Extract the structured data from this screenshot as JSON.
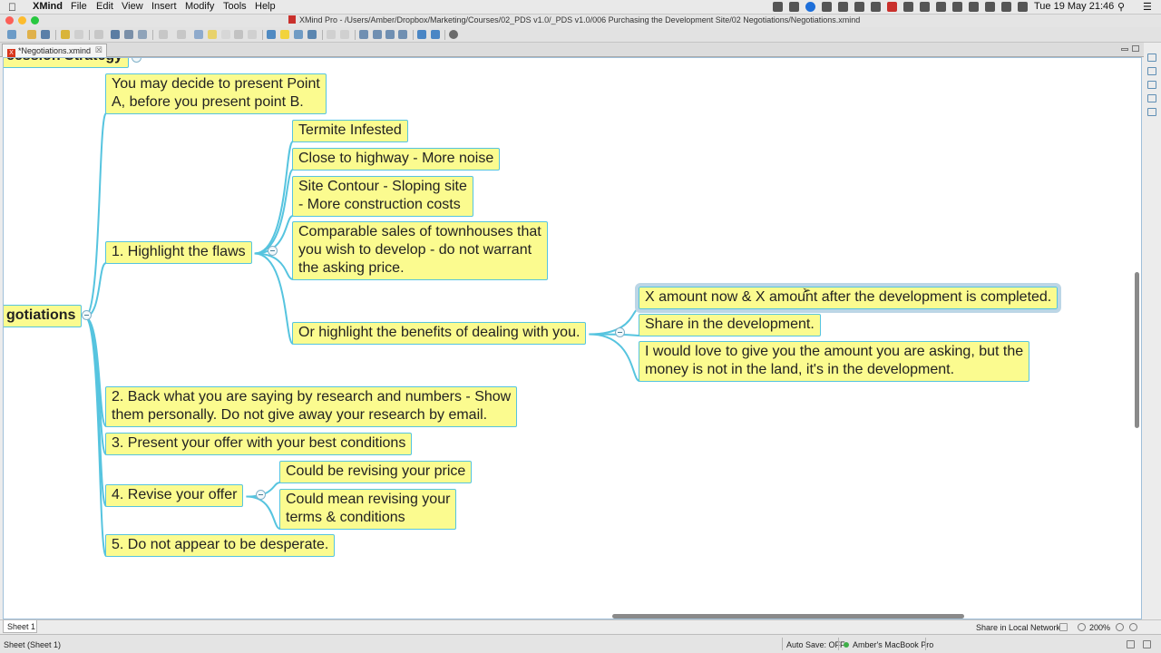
{
  "menubar": {
    "apple": "",
    "app_name": "XMind",
    "items": [
      "File",
      "Edit",
      "View",
      "Insert",
      "Modify",
      "Tools",
      "Help"
    ],
    "clock": "Tue 19 May  21:46"
  },
  "window": {
    "title": "XMind Pro - /Users/Amber/Dropbox/Marketing/Courses/02_PDS v1.0/_PDS v1.0/006 Purchasing the Development Site/02 Negotiations/Negotiations.xmind"
  },
  "editor_tab": {
    "label": "*Negotiations.xmind",
    "close": "☒"
  },
  "mindmap": {
    "parent_partial": "cession Strategy",
    "central_partial": "gotiations",
    "branches": [
      {
        "label": "You may decide to present Point\nA, before you present point B."
      },
      {
        "label": "1. Highlight the flaws",
        "children": [
          {
            "label": "Termite Infested"
          },
          {
            "label": "Close to highway - More noise"
          },
          {
            "label": "Site Contour - Sloping site\n- More construction costs"
          },
          {
            "label": "Comparable sales of townhouses that\nyou wish to develop - do not warrant\nthe asking price."
          },
          {
            "label": "Or highlight the benefits of dealing with you.",
            "children": [
              {
                "label": "X amount now & X amount after the development is completed.",
                "selected": true
              },
              {
                "label": "Share in the development."
              },
              {
                "label": "I would love to give you the amount you are asking, but the\nmoney is not in the land, it's in the development."
              }
            ]
          }
        ]
      },
      {
        "label": "2. Back what you are saying by research and numbers - Show\nthem personally. Do not give away your research by email."
      },
      {
        "label": "3. Present your offer with your best conditions"
      },
      {
        "label": "4. Revise your offer",
        "children": [
          {
            "label": "Could be revising your price"
          },
          {
            "label": "Could mean revising your\nterms & conditions"
          }
        ]
      },
      {
        "label": "5. Do not appear to be desperate."
      }
    ]
  },
  "sheet_bar": {
    "sheet_tab": "Sheet 1",
    "share": "Share in Local Network",
    "zoom": "200%"
  },
  "status_bar": {
    "sheet": "Sheet (Sheet 1)",
    "autosave": "Auto Save: OFF",
    "network": "Amber's MacBook Pro"
  },
  "colors": {
    "topic_fill": "#fbfb8f",
    "topic_border": "#56c4df",
    "connector": "#56c4df"
  }
}
